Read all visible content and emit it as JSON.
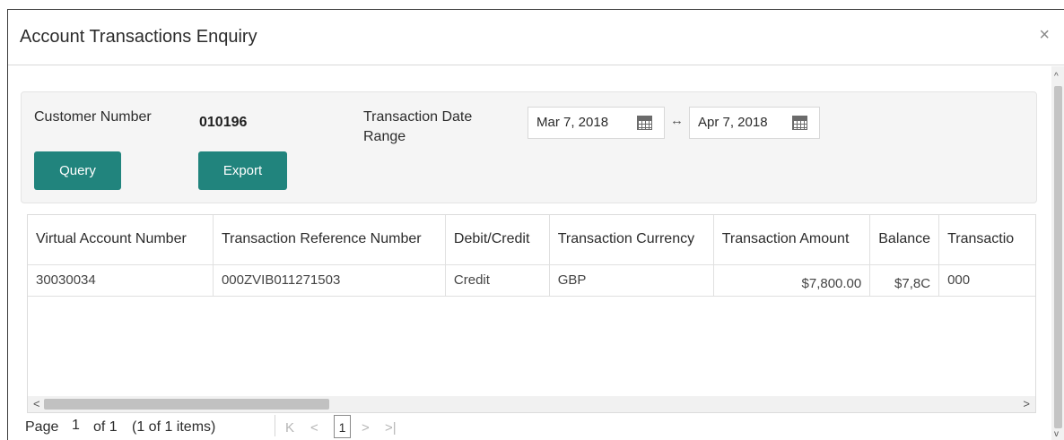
{
  "dialog": {
    "title": "Account Transactions Enquiry",
    "close_glyph": "×"
  },
  "filter": {
    "customer_number_label": "Customer Number",
    "customer_number_value": "010196",
    "date_range_label_line1": "Transaction Date",
    "date_range_label_line2": "Range",
    "date_from": "Mar 7, 2018",
    "date_to": "Apr 7, 2018",
    "range_separator": "↔",
    "query_label": "Query",
    "export_label": "Export"
  },
  "table": {
    "columns": [
      "Virtual Account Number",
      "Transaction Reference Number",
      "Debit/Credit",
      "Transaction Currency",
      "Transaction Amount",
      "Balance",
      "Transactio"
    ],
    "rows": [
      {
        "virtual_account_number": "30030034",
        "transaction_reference_number": "000ZVIB011271503",
        "debit_credit": "Credit",
        "transaction_currency": "GBP",
        "transaction_amount": "$7,800.00",
        "balance": "$7,8C",
        "transaction_extra": "000"
      }
    ]
  },
  "scrollbars": {
    "left_arrow": "<",
    "right_arrow": ">",
    "up_arrow": "^",
    "down_arrow": "v"
  },
  "pager": {
    "page_label": "Page",
    "current_page": "1",
    "of_text": "of 1",
    "items_text": "(1 of 1 items)",
    "first_glyph": "K",
    "prev_glyph": "<",
    "page_button": "1",
    "next_glyph": ">",
    "last_glyph": ">|"
  },
  "colors": {
    "button_accent": "#21847d",
    "panel_background": "#f5f5f5"
  },
  "icons": [
    "close-icon",
    "calendar-icon",
    "range-arrow-icon",
    "chevron-left-icon",
    "chevron-right-icon",
    "first-page-icon",
    "last-page-icon"
  ]
}
